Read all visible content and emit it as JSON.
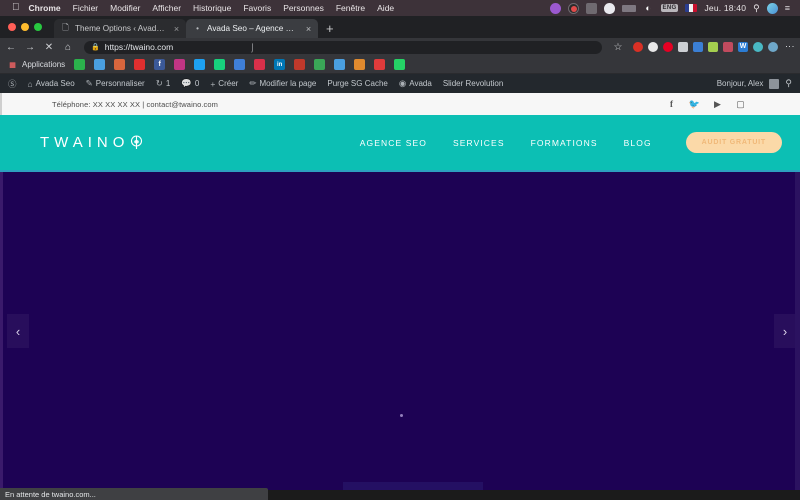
{
  "os_menubar": {
    "apple_icon": "apple-logo",
    "app_name": "Chrome",
    "menus": [
      "Fichier",
      "Modifier",
      "Afficher",
      "Historique",
      "Favoris",
      "Personnes",
      "Fenêtre",
      "Aide"
    ],
    "status_icons": [
      "circle-purple-icon",
      "record-red-icon",
      "screen-icon",
      "cloud-icon",
      "battery-icon",
      "wifi-icon"
    ],
    "input_source": "ENG",
    "flag": "fr-flag-icon",
    "clock": "Jeu. 18:40",
    "search_icon": "search-icon",
    "siri_icon": "siri-icon",
    "control_center_icon": "control-center-icon"
  },
  "browser": {
    "window_controls": [
      "close",
      "minimize",
      "zoom"
    ],
    "tabs": [
      {
        "title": "Theme Options ‹ Avada Seo —",
        "favicon": "page-icon",
        "active": false,
        "close_label": "×"
      },
      {
        "title": "Avada Seo – Agence SEO",
        "favicon": "loading-icon",
        "active": true,
        "close_label": "×"
      }
    ],
    "new_tab_label": "+",
    "nav": {
      "back": "←",
      "forward": "→",
      "stop": "✕",
      "home": "⌂"
    },
    "omnibox": {
      "lock_icon": "lock-icon",
      "url": "https://twaino.com",
      "cursor_icon": "text-cursor-icon"
    },
    "toolbar_right": {
      "bookmark_star": "☆",
      "extensions": [
        "ext-red-icon",
        "ext-white-cloud-icon",
        "ext-pinterest-icon",
        "ext-grid-icon",
        "ext-blue-icon",
        "ext-pencil-icon",
        "ext-pink-icon",
        "ext-word-icon",
        "ext-teal-icon"
      ],
      "profile_icon": "profile-avatar-icon",
      "menu_icon": "kebab-menu-icon"
    },
    "bookmarks_bar": {
      "apps_label": "Applications",
      "apps_icon": "apps-grid-icon",
      "items": [
        "semrush-icon",
        "mail-icon",
        "analytics-icon",
        "youtube-icon",
        "facebook-icon",
        "instagram-icon",
        "twitter-icon",
        "green-diamond-icon",
        "blue-page-icon",
        "red-pin-icon",
        "linkedin-icon",
        "ahrefs-icon",
        "spreadsheet-icon",
        "trello-icon",
        "chart-icon",
        "video-icon",
        "whatsapp-icon"
      ]
    },
    "status_text": "En attente de twaino.com..."
  },
  "wp_admin_bar": {
    "logo_icon": "wordpress-icon",
    "items": [
      {
        "label": "Avada Seo",
        "icon": "house-icon"
      },
      {
        "label": "Personnaliser",
        "icon": "brush-icon"
      },
      {
        "label": "1",
        "icon": "refresh-icon"
      },
      {
        "label": "0",
        "icon": "comment-icon"
      },
      {
        "label": "Créer",
        "icon": "plus-icon"
      },
      {
        "label": "Modifier la page",
        "icon": "pencil-icon"
      },
      {
        "label": "Purge SG Cache",
        "icon": ""
      },
      {
        "label": "Avada",
        "icon": "avada-icon"
      },
      {
        "label": "Slider Revolution",
        "icon": ""
      }
    ],
    "greeting": "Bonjour, Alex",
    "avatar": "user-avatar",
    "search_icon": "search-icon"
  },
  "site": {
    "topbar": {
      "contact": "Téléphone: XX XX XX XX  |  contact@twaino.com",
      "social": [
        "facebook-icon",
        "twitter-icon",
        "youtube-icon",
        "instagram-icon"
      ]
    },
    "header": {
      "logo_text": "TWAINO",
      "logo_mark": "leaf-icon",
      "nav_links": [
        "AGENCE SEO",
        "SERVICES",
        "FORMATIONS",
        "BLOG"
      ],
      "cta_label": "AUDIT GRATUIT",
      "bg_color": "#0cbfb4",
      "cta_color": "#fbd9a8"
    },
    "hero": {
      "bg_color": "#1d0254",
      "prev_arrow": "‹",
      "next_arrow": "›",
      "loading_indicator": "loading-dot"
    }
  }
}
